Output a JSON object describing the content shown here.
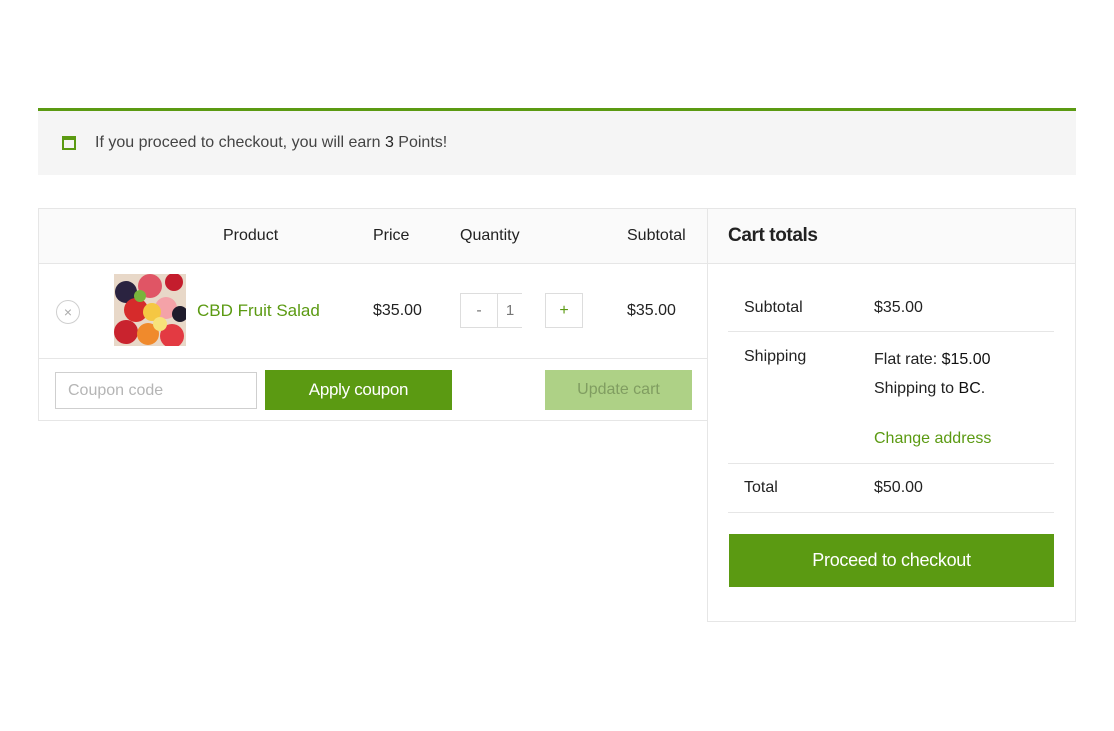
{
  "notice": {
    "text_before": "If you proceed to checkout, you will earn ",
    "points": "3",
    "text_after": " Points!"
  },
  "cart": {
    "headers": {
      "product": "Product",
      "price": "Price",
      "quantity": "Quantity",
      "subtotal": "Subtotal"
    },
    "items": [
      {
        "remove_glyph": "×",
        "product_name": "CBD Fruit Salad",
        "price": "$35.00",
        "quantity": "1",
        "subtotal": "$35.00"
      }
    ],
    "qty_minus": "-",
    "qty_plus": "+",
    "coupon_placeholder": "Coupon code",
    "apply_coupon_label": "Apply coupon",
    "update_cart_label": "Update cart"
  },
  "totals": {
    "title": "Cart totals",
    "subtotal_label": "Subtotal",
    "subtotal_value": "$35.00",
    "shipping_label": "Shipping",
    "flat_rate_label": "Flat rate: ",
    "flat_rate_value": "$15.00",
    "shipping_to_label": "Shipping to ",
    "shipping_to_value": "BC",
    "shipping_to_suffix": ".",
    "change_address_label": "Change address",
    "total_label": "Total",
    "total_value": "$50.00",
    "checkout_label": "Proceed to checkout"
  },
  "colors": {
    "accent": "#5b9a12",
    "accent_disabled": "#aed186",
    "notice_bg": "#f5f5f5",
    "border": "#e6e6e6"
  },
  "icons": {
    "notice": "calendar-window-icon",
    "remove": "remove-circle-icon",
    "product_thumb": "fruit-candy-thumbnail"
  }
}
